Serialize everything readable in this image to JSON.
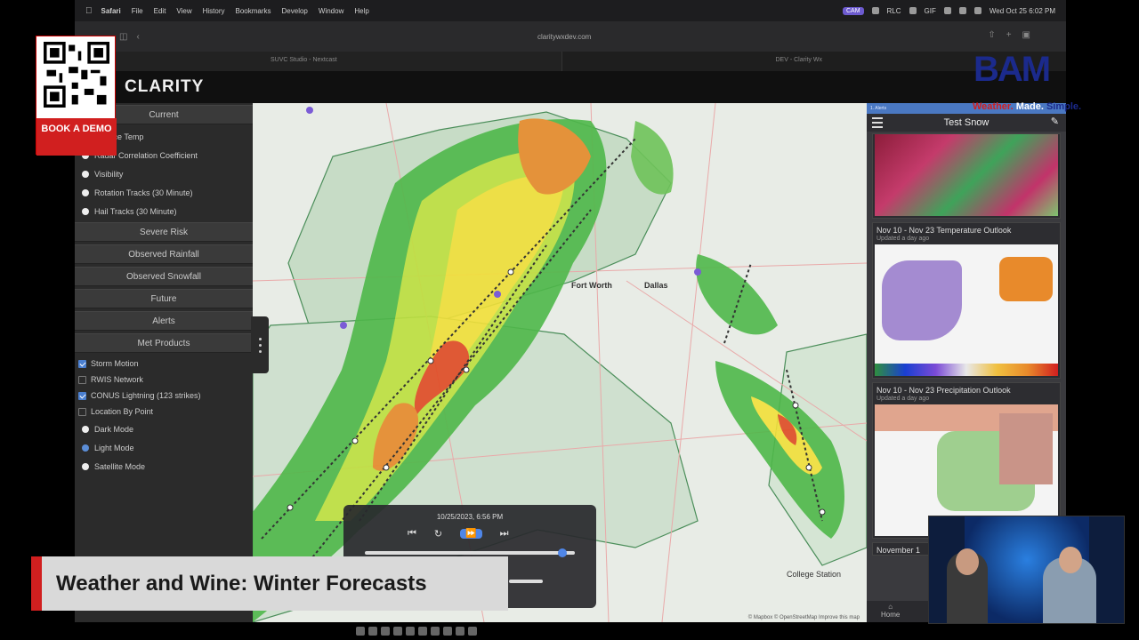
{
  "menubar": {
    "app": "Safari",
    "items": [
      "File",
      "Edit",
      "View",
      "History",
      "Bookmarks",
      "Develop",
      "Window",
      "Help"
    ],
    "status_chip": "CAM",
    "status_text": "RLC",
    "gif": "GIF",
    "datetime": "Wed Oct 25 6:02 PM"
  },
  "browser": {
    "url": "claritywxdev.com",
    "tab_left": "SUVC Studio - Nextcast",
    "tab_right": "DEV - Clarity Wx"
  },
  "app": {
    "logo": "CLARITY"
  },
  "left_panel": {
    "sections": {
      "current": "Current",
      "severe_risk": "Severe Risk",
      "observed_rainfall": "Observed Rainfall",
      "observed_snowfall": "Observed Snowfall",
      "future": "Future",
      "alerts": "Alerts",
      "met_products": "Met Products"
    },
    "current_layers": [
      {
        "label": "Surface Temp"
      },
      {
        "label": "Radar Correlation Coefficient"
      },
      {
        "label": "Visibility"
      },
      {
        "label": "Rotation Tracks (30 Minute)"
      },
      {
        "label": "Hail Tracks (30 Minute)"
      }
    ],
    "met_products": [
      {
        "label": "Storm Motion",
        "checked": true
      },
      {
        "label": "RWIS Network",
        "checked": false
      },
      {
        "label": "CONUS Lightning (123 strikes)",
        "checked": true
      },
      {
        "label": "Location By Point",
        "checked": false
      }
    ],
    "modes": [
      {
        "label": "Dark Mode",
        "selected": false
      },
      {
        "label": "Light Mode",
        "selected": true
      },
      {
        "label": "Satellite Mode",
        "selected": false
      }
    ]
  },
  "map": {
    "cities": {
      "fort_worth": "Fort Worth",
      "dallas": "Dallas",
      "college_station": "College Station"
    },
    "attribution": "© Mapbox © OpenStreetMap  Improve this map"
  },
  "player": {
    "timestamp": "10/25/2023, 6:56 PM",
    "progress": 0.94
  },
  "right_panel": {
    "top_label": "1. Alerts",
    "title": "Test Snow",
    "cards": [
      {
        "title": "Nov 10 - Nov 23 Temperature Outlook",
        "updated": "Updated a day ago"
      },
      {
        "title": "Nov 10 - Nov 23 Precipitation Outlook",
        "updated": "Updated a day ago"
      },
      {
        "title": "November 1",
        "updated": ""
      }
    ],
    "home": "Home"
  },
  "overlay": {
    "qr_cta": "BOOK A DEMO",
    "brand": "BAM",
    "tagline_1": "Weather.",
    "tagline_2": "Made.",
    "tagline_3": "Simple.",
    "lower_third": "Weather and Wine: Winter Forecasts"
  },
  "colors": {
    "accent_red": "#d11f1f",
    "brand_blue": "#1b2a8c",
    "player_blue": "#4f86e8"
  }
}
